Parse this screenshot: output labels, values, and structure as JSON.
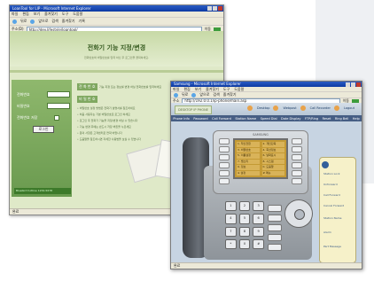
{
  "window_back": {
    "title": "LoanTool for LIP - Microsoft Internet Explorer",
    "menu": [
      "파일",
      "편집",
      "보기",
      "즐겨찾기",
      "도구",
      "도움말"
    ],
    "toolbar": [
      "뒤로",
      "앞으로",
      "검색",
      "즐겨찾기",
      "기록"
    ],
    "address_label": "주소(D)",
    "address_value": "http://dev.lifestyle/loantool/",
    "go_label": "이동",
    "page_title": "전화기 기능 지정/변경",
    "page_subtitle": "전화번호와 비밀번호를 입력 하신 후 로그인을 클릭하세요.",
    "form": {
      "label1": "전화번호",
      "label2": "비밀번호",
      "label3": "전화번호 저장",
      "button": "로그인",
      "footer": "Bluebird hotline 1234-5678"
    },
    "info": {
      "label1": "전 화 번 호",
      "note1": "기능 지정 또는 정보를 변경 하실 전화번호를 입력하세요",
      "label2": "비 밀 번 호",
      "lines": [
        "• 비밀번호 설정 방법은 전화기 설명서를 참조하세요",
        "• 처음 사용자는 기본 비밀번호로 로그인 하세요",
        "• 로그인 후 전화기 기능을 지정/변경 하실 수 있습니다",
        "• 기능 변경 후에는 반드시 저장 버튼을 누르세요",
        "• 문의 사항은 고객센터로 연락 바랍니다",
        "• 도움말을 참조하시면 자세한 사용법을 보실 수 있습니다"
      ]
    },
    "status": "완료"
  },
  "window_front": {
    "title": "Samsung - Microsoft Internet Explorer",
    "menu": [
      "파일",
      "편집",
      "보기",
      "즐겨찾기",
      "도구",
      "도움말"
    ],
    "toolbar": [
      "뒤로",
      "앞으로",
      "검색",
      "즐겨찾기"
    ],
    "address_label": "주소",
    "address_value": "http://192.0.0.1/ip-phone/main.asp",
    "go_label": "이동",
    "logo_text": "DESKTOP IP PHONE",
    "header_links": [
      "Desktop",
      "Webpost",
      "Call Recorder",
      "Logout"
    ],
    "nav": [
      "Phone Info",
      "Password",
      "Call Forward",
      "Station Name",
      "Speed Dial",
      "Date Display",
      "FTP/Ring",
      "Reset",
      "Ring Bell",
      "Help"
    ],
    "lcd_brand": "SAMSUNG",
    "lcd_items": [
      "1. 착신전환",
      "2. 개인단축",
      "3. 비밀번호",
      "4. 회선정보",
      "5. 이름설정",
      "6. 날짜표시",
      "7. 벨소리",
      "8. 시스템",
      "9. 정보",
      "0. 도움말",
      "※ 설정",
      "# 메뉴"
    ],
    "keypad": [
      "1",
      "2",
      "3",
      "4",
      "5",
      "6",
      "7",
      "8",
      "9",
      "*",
      "0",
      "#"
    ],
    "side_menu": [
      "Station Lock",
      "Unforward",
      "Call Forward",
      "Cancel Forward",
      "Station Name",
      "Alarm",
      "Part Message"
    ],
    "status": "완료"
  }
}
